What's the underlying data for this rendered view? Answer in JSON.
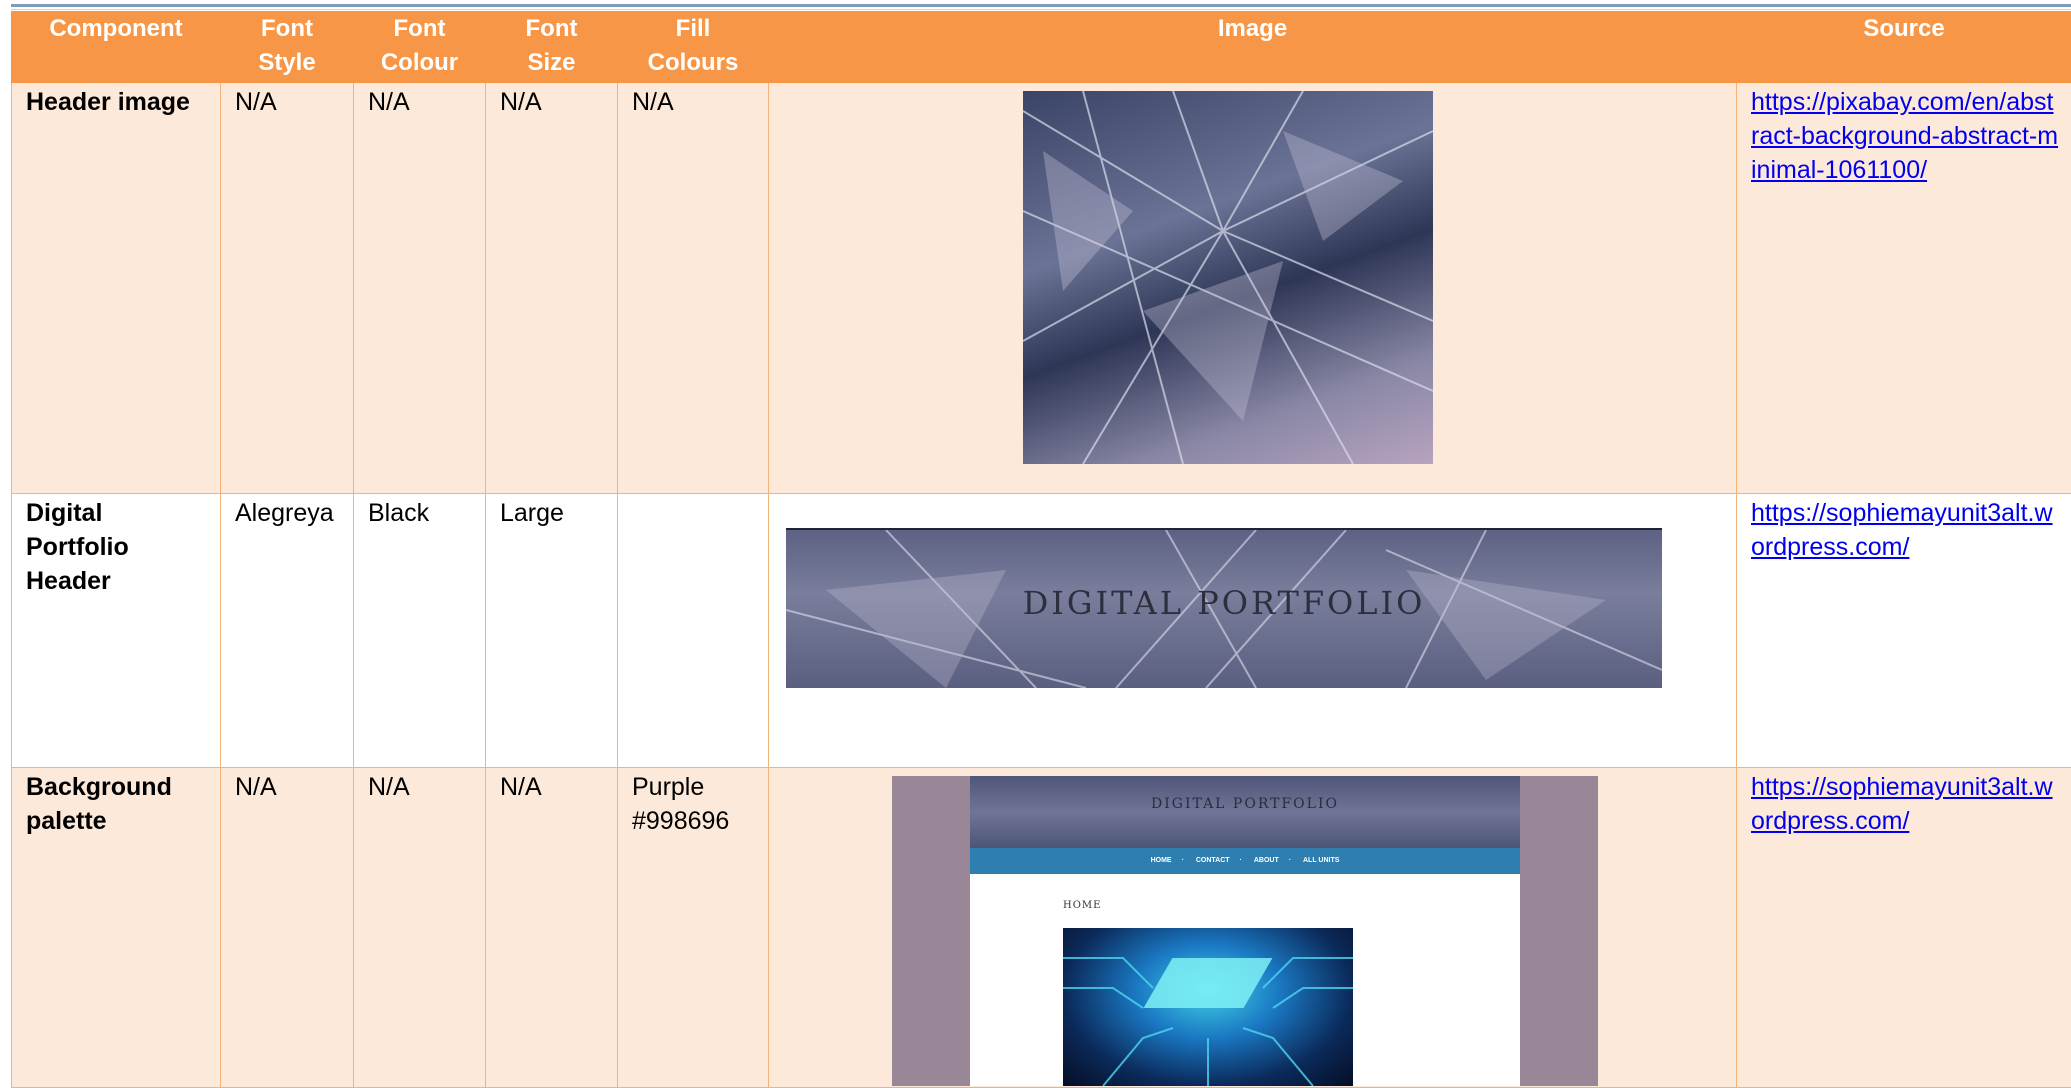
{
  "table": {
    "headers": [
      "Component",
      "Font Style",
      "Font Colour",
      "Font Size",
      "Fill Colours",
      "Image",
      "Source"
    ],
    "header_lines": [
      [
        "Component"
      ],
      [
        "Font",
        "Style"
      ],
      [
        "Font",
        "Colour"
      ],
      [
        "Font",
        "Size"
      ],
      [
        "Fill",
        "Colours"
      ],
      [
        "Image"
      ],
      [
        "Source"
      ]
    ],
    "rows": [
      {
        "component": "Header image",
        "font_style": "N/A",
        "font_colour": "N/A",
        "font_size": "N/A",
        "fill_colours": "N/A",
        "image": "abstract-background-icon",
        "source": "https://pixabay.com/en/abstract-background-abstract-minimal-1061100/"
      },
      {
        "component": "Digital Portfolio Header",
        "font_style": "Alegreya",
        "font_colour": "Black",
        "font_size": "Large",
        "fill_colours": "",
        "image_text": "DIGITAL PORTFOLIO",
        "source": "https://sophiemayunit3alt.wordpress.com/"
      },
      {
        "component": "Background palette",
        "font_style": "N/A",
        "font_colour": "N/A",
        "font_size": "N/A",
        "fill_colours_line1": "Purple",
        "fill_colours_line2": "#998696",
        "image": {
          "banner_text": "DIGITAL PORTFOLIO",
          "nav": [
            "HOME",
            "CONTACT",
            "ABOUT",
            "ALL UNITS"
          ],
          "page_title": "HOME"
        },
        "source": "https://sophiemayunit3alt.wordpress.com/"
      }
    ]
  },
  "colors": {
    "header_fill": "#f79646",
    "peach_fill": "#fde9d9",
    "border": "#f5b17a",
    "link": "#0000ee",
    "palette_purple": "#998696"
  }
}
